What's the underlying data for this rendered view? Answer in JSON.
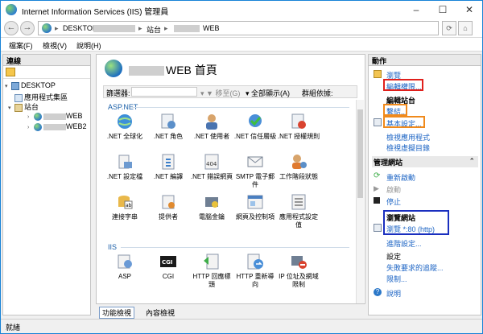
{
  "window": {
    "title": "Internet Information Services (IIS) 管理員",
    "minimize": "–",
    "maximize": "☐",
    "close": "✕"
  },
  "address": {
    "crumbs": [
      "DESKTOP",
      "站台",
      "WEB"
    ],
    "separators": [
      "▸",
      "▸",
      "▸"
    ]
  },
  "menu": {
    "items": [
      "檔案(F)",
      "檢視(V)",
      "說明(H)"
    ]
  },
  "connections": {
    "header": "連線",
    "tree": [
      {
        "label": "DESKTOP"
      },
      {
        "label": "應用程式集區"
      },
      {
        "label": "站台"
      },
      {
        "label": "WEB"
      },
      {
        "label": "WEB2"
      }
    ]
  },
  "center": {
    "title": "WEB 首頁",
    "filter_label": "篩選器:",
    "go_label": "移至(G)",
    "show_all_label": "全部顯示(A)",
    "group_by_label": "群組依據:",
    "groups": [
      {
        "name": "ASP.NET",
        "features": [
          ".NET 全球化",
          ".NET 角色",
          ".NET 使用者",
          ".NET 信任層級",
          ".NET 授權規則",
          ".NET 設定檔",
          ".NET 編譯",
          ".NET 錯誤網頁",
          "SMTP 電子郵件",
          "工作階段狀態",
          "連接字串",
          "提供者",
          "電腦金鑰",
          "網頁及控制項",
          "應用程式設定值"
        ]
      },
      {
        "name": "IIS",
        "features": [
          "ASP",
          "CGI",
          "HTTP 回應標頭",
          "HTTP 重新導向",
          "IP 位址及網域限制"
        ]
      }
    ],
    "view_tabs": [
      "功能檢視",
      "內容檢視"
    ]
  },
  "actions": {
    "header": "動作",
    "explore": "瀏覽",
    "edit_permissions": "編輯權限...",
    "edit_site_section": "編輯站台",
    "bindings": "繫結...",
    "basic_settings": "基本設定...",
    "view_apps": "檢視應用程式",
    "view_vdirs": "檢視虛擬目錄",
    "manage_section": "管理網站",
    "restart": "重新啟動",
    "start": "啟動",
    "stop": "停止",
    "browse_section": "瀏覽網站",
    "browse_port": "瀏覽 *:80 (http)",
    "advanced_settings": "進階設定...",
    "config_section": "設定",
    "failed_request_tracing": "失敗要求的追蹤...",
    "limits": "限制...",
    "help": "說明"
  },
  "status": {
    "text": "就緒"
  },
  "colors": {
    "red_box": "#e0201c",
    "orange_box": "#f08a1c",
    "blue_box": "#1a2fbf",
    "link": "#1c64c4"
  }
}
